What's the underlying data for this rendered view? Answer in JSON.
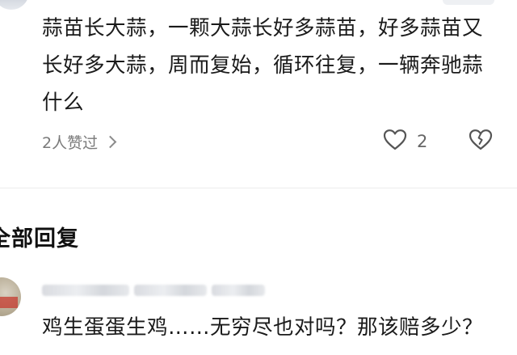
{
  "comment": {
    "text": "蒜苗长大蒜，一颗大蒜长好多蒜苗，好多蒜苗又长好多大蒜，周而复始，循环往复，一辆奔驰蒜什么",
    "likes_summary": "2人赞过",
    "like_count": "2",
    "like_icon": "heart-outline-icon",
    "dislike_icon": "broken-heart-icon"
  },
  "section": {
    "title": "全部回复"
  },
  "reply": {
    "username_blurred": true,
    "text": "鸡生蛋蛋生鸡……无穷尽也对吗？那该赔多少？"
  },
  "colors": {
    "text_primary": "#1a1a1a",
    "text_secondary": "#7a7a7a",
    "divider": "#ececec",
    "background": "#ffffff"
  }
}
